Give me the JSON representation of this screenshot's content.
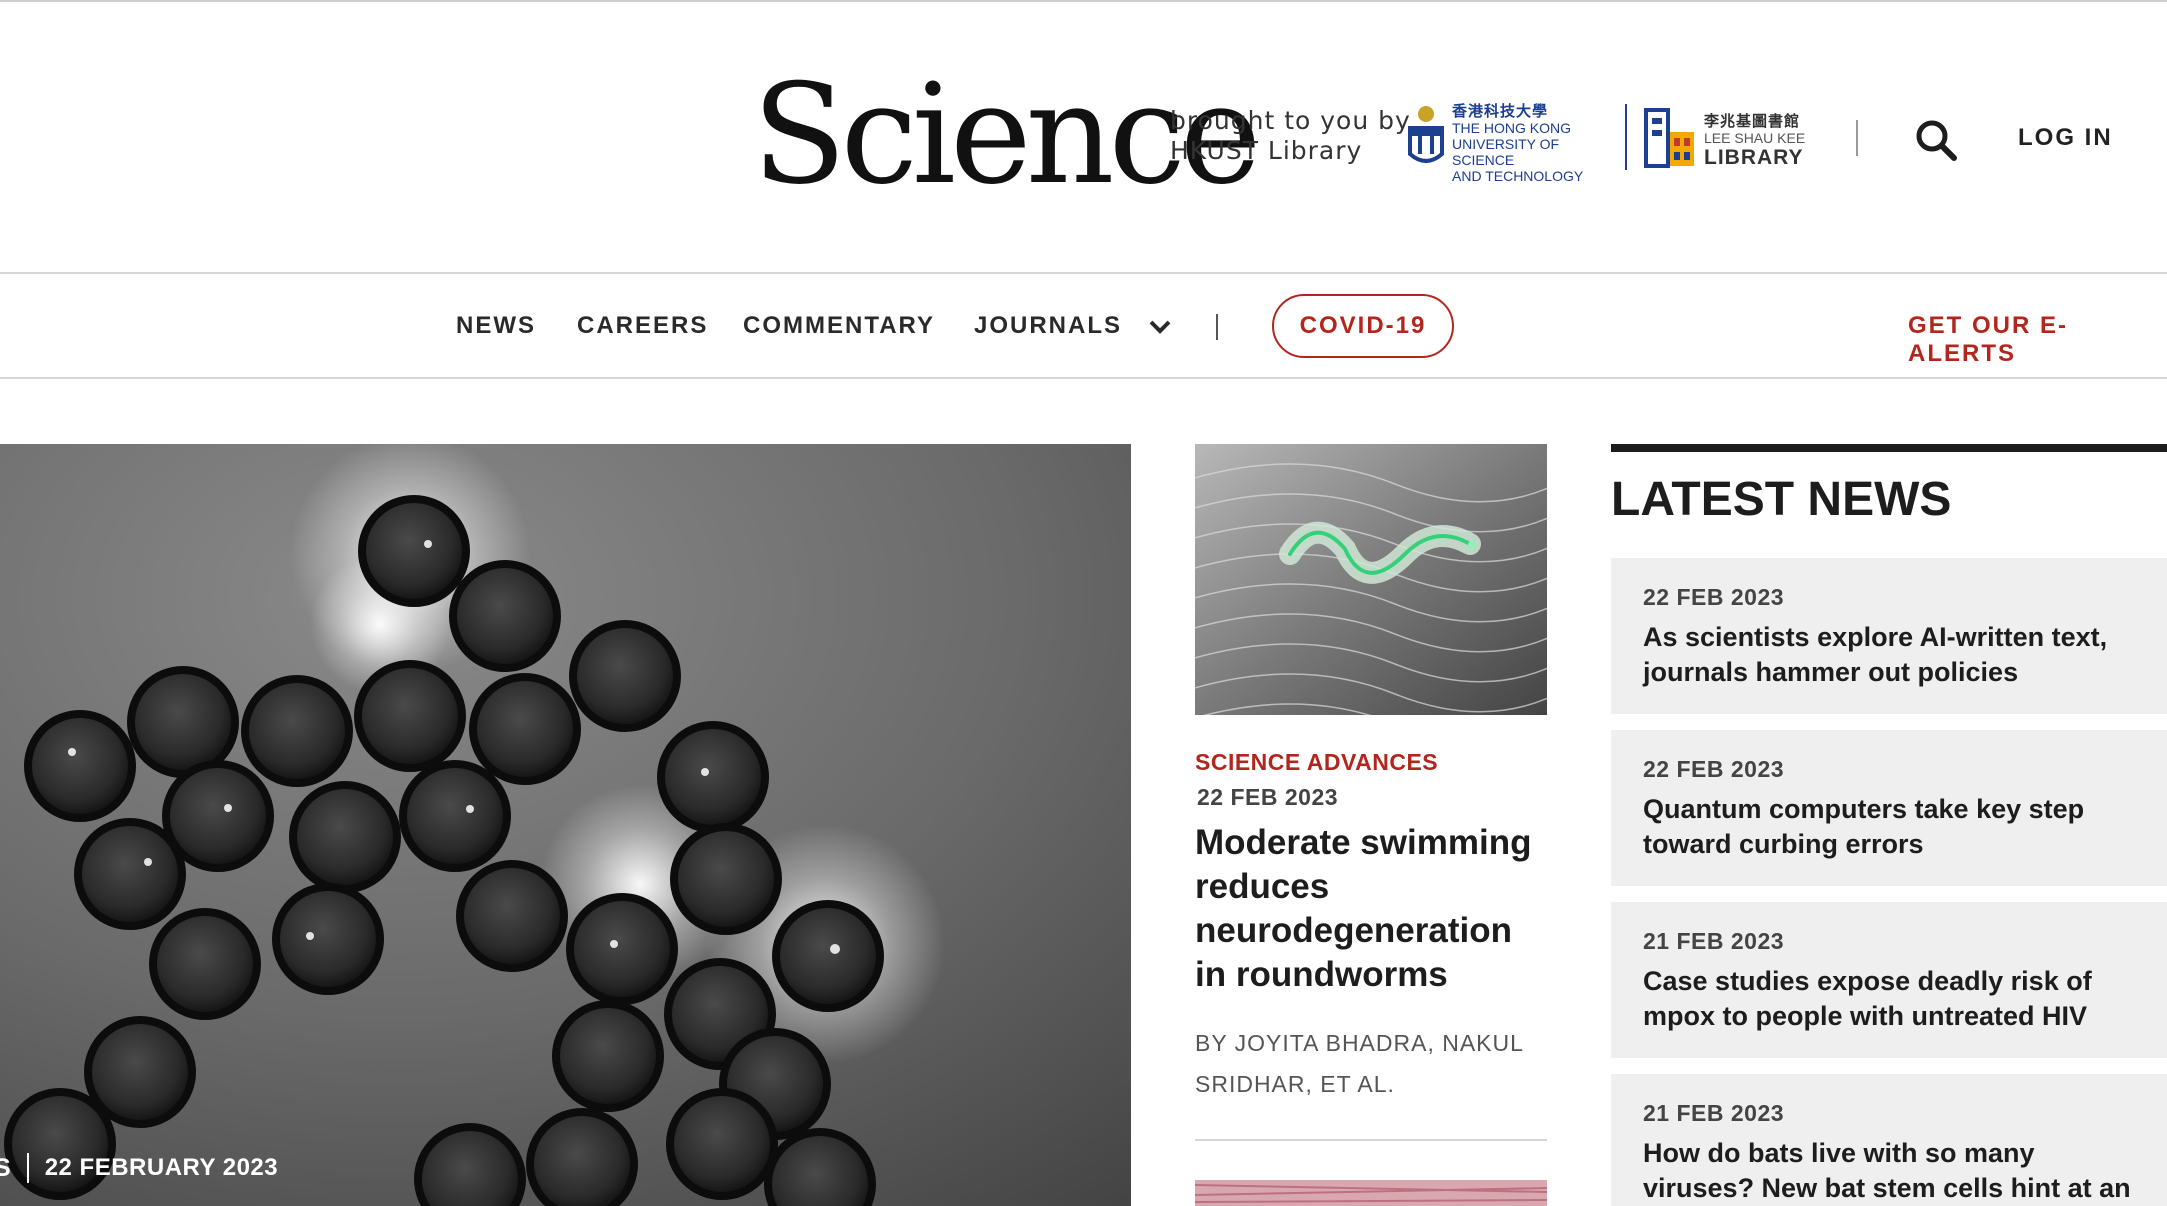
{
  "header": {
    "logo_text": "Science",
    "brought_line1": "brought to you by",
    "brought_line2": "HKUST Library",
    "hkust": {
      "cn": "香港科技大學",
      "line1": "THE HONG KONG",
      "line2": "UNIVERSITY OF SCIENCE",
      "line3": "AND TECHNOLOGY"
    },
    "library": {
      "cn": "李兆基圖書館",
      "line1": "LEE SHAU KEE",
      "line2": "LIBRARY"
    },
    "login_label": "LOG IN"
  },
  "nav": {
    "items": [
      "NEWS",
      "CAREERS",
      "COMMENTARY",
      "JOURNALS"
    ],
    "covid_label": "COVID-19",
    "ealerts_label": "GET OUR E-ALERTS"
  },
  "hero": {
    "category": "S",
    "date": "22 FEBRUARY 2023"
  },
  "featured": {
    "journal": "SCIENCE ADVANCES",
    "date": "22 FEB 2023",
    "title": "Moderate swimming reduces neurodegeneration in roundworms",
    "by": "BY",
    "authors": [
      "JOYITA BHADRA,",
      "NAKUL SRIDHAR,",
      "ET AL."
    ]
  },
  "latest_news": {
    "heading": "LATEST NEWS",
    "items": [
      {
        "date": "22 FEB 2023",
        "title": "As scientists explore AI-written text, journals hammer out policies"
      },
      {
        "date": "22 FEB 2023",
        "title": "Quantum computers take key step toward curbing errors"
      },
      {
        "date": "21 FEB 2023",
        "title": "Case studies expose deadly risk of mpox to people with untreated HIV"
      },
      {
        "date": "21 FEB 2023",
        "title": "How do bats live with so many viruses? New bat stem cells hint at an answer"
      }
    ]
  }
}
